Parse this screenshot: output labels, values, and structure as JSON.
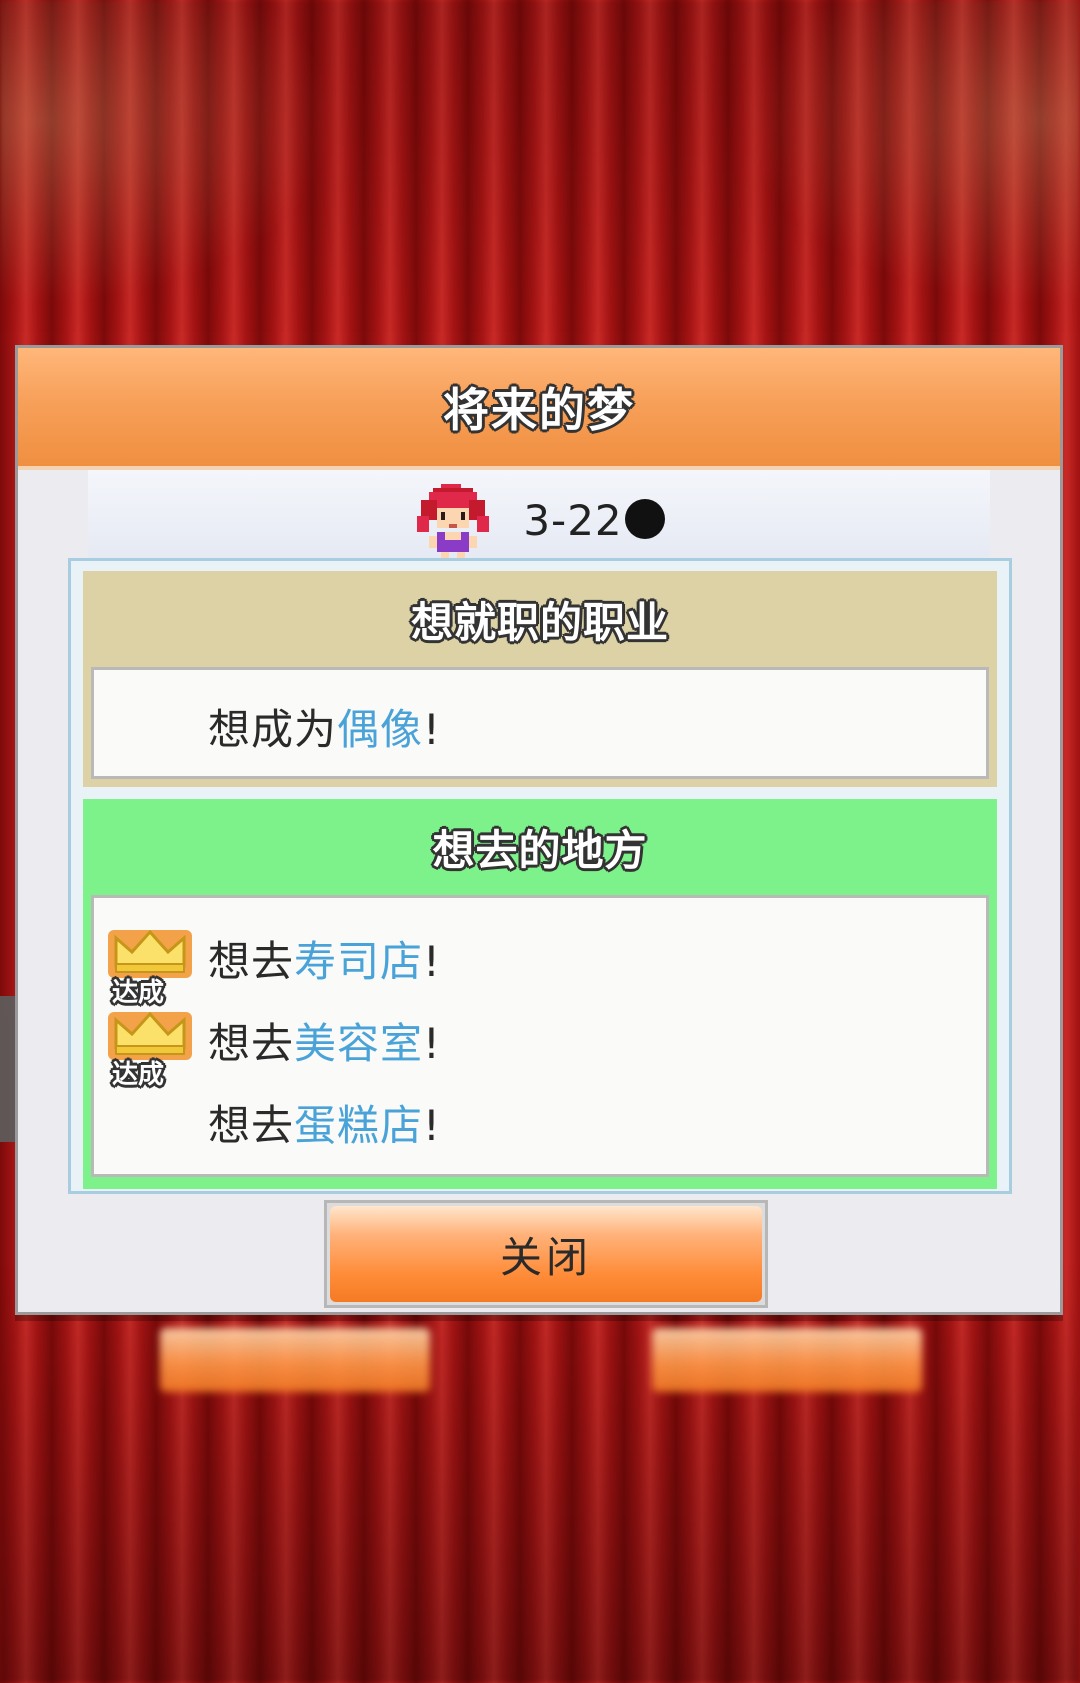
{
  "dialog": {
    "title": "将来的梦",
    "character_name": "3-22"
  },
  "job_section": {
    "heading": "想就职的职业",
    "wish_prefix": "想成为",
    "wish_highlight": "偶像",
    "wish_suffix": "!"
  },
  "place_section": {
    "heading": "想去的地方",
    "items": [
      {
        "prefix": "想去",
        "highlight": "寿司店",
        "suffix": "!",
        "achieved": true,
        "badge": "达成"
      },
      {
        "prefix": "想去",
        "highlight": "美容室",
        "suffix": "!",
        "achieved": true,
        "badge": "达成"
      },
      {
        "prefix": "想去",
        "highlight": "蛋糕店",
        "suffix": "!",
        "achieved": false
      }
    ]
  },
  "close_label": "关闭",
  "icons": {
    "achievement": "crown-icon",
    "side_tab": "chevron-right-icon"
  },
  "colors": {
    "header_orange": "#f7a05a",
    "job_bg": "#dcd2a6",
    "place_bg": "#7ef28a",
    "highlight_text": "#4aa3d8"
  }
}
